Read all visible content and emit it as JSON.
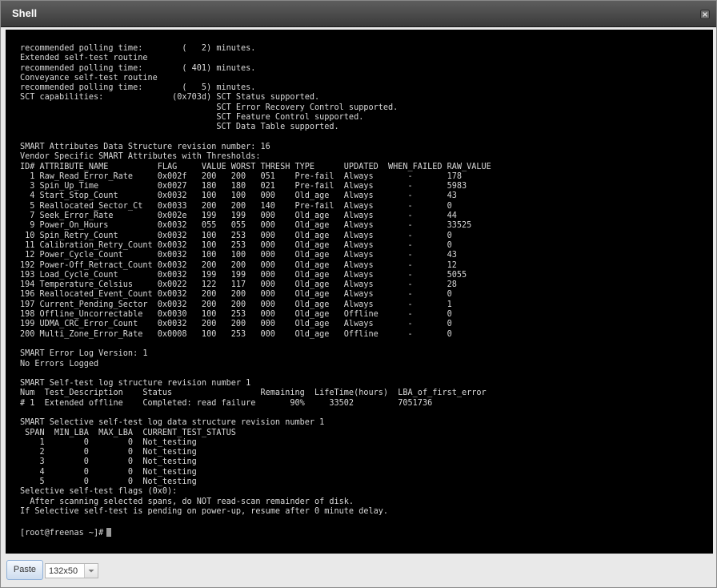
{
  "window": {
    "title": "Shell",
    "close_icon": "close-icon"
  },
  "terminal": {
    "output": "recommended polling time:        (   2) minutes.\nExtended self-test routine\nrecommended polling time:        ( 401) minutes.\nConveyance self-test routine\nrecommended polling time:        (   5) minutes.\nSCT capabilities:              (0x703d) SCT Status supported.\n                                        SCT Error Recovery Control supported.\n                                        SCT Feature Control supported.\n                                        SCT Data Table supported.\n\nSMART Attributes Data Structure revision number: 16\nVendor Specific SMART Attributes with Thresholds:\nID# ATTRIBUTE_NAME          FLAG     VALUE WORST THRESH TYPE      UPDATED  WHEN_FAILED RAW_VALUE\n  1 Raw_Read_Error_Rate     0x002f   200   200   051    Pre-fail  Always       -       178\n  3 Spin_Up_Time            0x0027   180   180   021    Pre-fail  Always       -       5983\n  4 Start_Stop_Count        0x0032   100   100   000    Old_age   Always       -       43\n  5 Reallocated_Sector_Ct   0x0033   200   200   140    Pre-fail  Always       -       0\n  7 Seek_Error_Rate         0x002e   199   199   000    Old_age   Always       -       44\n  9 Power_On_Hours          0x0032   055   055   000    Old_age   Always       -       33525\n 10 Spin_Retry_Count        0x0032   100   253   000    Old_age   Always       -       0\n 11 Calibration_Retry_Count 0x0032   100   253   000    Old_age   Always       -       0\n 12 Power_Cycle_Count       0x0032   100   100   000    Old_age   Always       -       43\n192 Power-Off_Retract_Count 0x0032   200   200   000    Old_age   Always       -       12\n193 Load_Cycle_Count        0x0032   199   199   000    Old_age   Always       -       5055\n194 Temperature_Celsius     0x0022   122   117   000    Old_age   Always       -       28\n196 Reallocated_Event_Count 0x0032   200   200   000    Old_age   Always       -       0\n197 Current_Pending_Sector  0x0032   200   200   000    Old_age   Always       -       1\n198 Offline_Uncorrectable   0x0030   100   253   000    Old_age   Offline      -       0\n199 UDMA_CRC_Error_Count    0x0032   200   200   000    Old_age   Always       -       0\n200 Multi_Zone_Error_Rate   0x0008   100   253   000    Old_age   Offline      -       0\n\nSMART Error Log Version: 1\nNo Errors Logged\n\nSMART Self-test log structure revision number 1\nNum  Test_Description    Status                  Remaining  LifeTime(hours)  LBA_of_first_error\n# 1  Extended offline    Completed: read failure       90%     33502         7051736\n\nSMART Selective self-test log data structure revision number 1\n SPAN  MIN_LBA  MAX_LBA  CURRENT_TEST_STATUS\n    1        0        0  Not_testing\n    2        0        0  Not_testing\n    3        0        0  Not_testing\n    4        0        0  Not_testing\n    5        0        0  Not_testing\nSelective self-test flags (0x0):\n  After scanning selected spans, do NOT read-scan remainder of disk.\nIf Selective self-test is pending on power-up, resume after 0 minute delay.",
    "prompt": "[root@freenas ~]#"
  },
  "toolbar": {
    "paste_label": "Paste",
    "size_value": "132x50",
    "size_arrow_icon": "chevron-down-icon"
  },
  "colors": {
    "terminal_bg": "#000000",
    "terminal_text": "#d8d8d8",
    "titlebar": "#4a4a4a"
  }
}
